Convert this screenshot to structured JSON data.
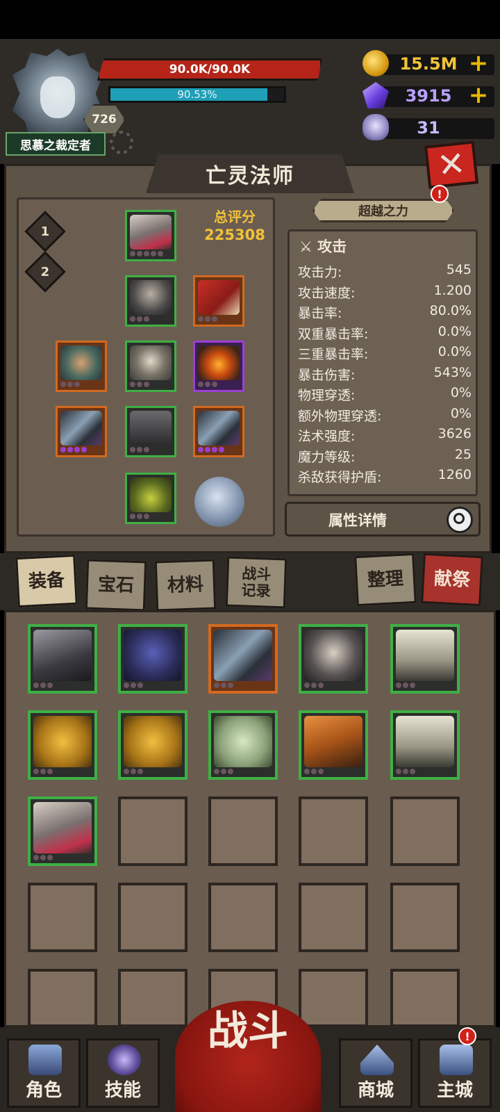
{
  "player": {
    "name": "思慕之裁定者",
    "level": "726",
    "hp_text": "90.0K/90.0K",
    "xp_text": "90.53%",
    "xp_fraction": 0.9053
  },
  "resources": [
    {
      "value": "15.5M",
      "icon": "gold-coin-icon",
      "color": "#f2c23a",
      "has_plus": true,
      "plus": "+"
    },
    {
      "value": "3915",
      "icon": "purple-gem-icon",
      "color": "#b9a0ff",
      "has_plus": true,
      "plus": "+"
    },
    {
      "value": "31",
      "icon": "ram-skull-icon",
      "color": "#c7b8ff",
      "has_plus": false
    }
  ],
  "panel": {
    "title": "亡灵法师",
    "close": "✕",
    "loadouts": [
      "1",
      "2"
    ],
    "score_label": "总评分",
    "score_value": "225308",
    "superpower_label": "超越之力",
    "alert": "!",
    "stats_header": "攻击",
    "stats_header_icon": "⚔",
    "stats": [
      {
        "label": "攻击力:",
        "value": "545"
      },
      {
        "label": "攻击速度:",
        "value": "1.200"
      },
      {
        "label": "暴击率:",
        "value": "80.0%"
      },
      {
        "label": "双重暴击率:",
        "value": "0.0%"
      },
      {
        "label": "三重暴击率:",
        "value": "0.0%"
      },
      {
        "label": "暴击伤害:",
        "value": "543%"
      },
      {
        "label": "物理穿透:",
        "value": "0%"
      },
      {
        "label": "额外物理穿透:",
        "value": "0%"
      },
      {
        "label": "法术强度:",
        "value": "3626"
      },
      {
        "label": "魔力等级:",
        "value": "25"
      },
      {
        "label": "杀敌获得护盾:",
        "value": "1260"
      }
    ],
    "detail_button": "属性详情"
  },
  "tabs": {
    "equipment": "装备",
    "gems": "宝石",
    "materials": "材料",
    "battle_log": "战斗\n记录",
    "sort": "整理",
    "sacrifice": "献祭"
  },
  "bottom_nav": {
    "character": "角色",
    "skills": "技能",
    "fight": "战斗",
    "shop": "商城",
    "main_city": "主城",
    "alert": "!"
  },
  "colors": {
    "hp": "#b52418",
    "xp": "#1f9fb8",
    "score": "#f2c23a",
    "rarity_green": "#3fb045",
    "rarity_orange": "#d26a20",
    "rarity_purple": "#9b3fd2"
  }
}
